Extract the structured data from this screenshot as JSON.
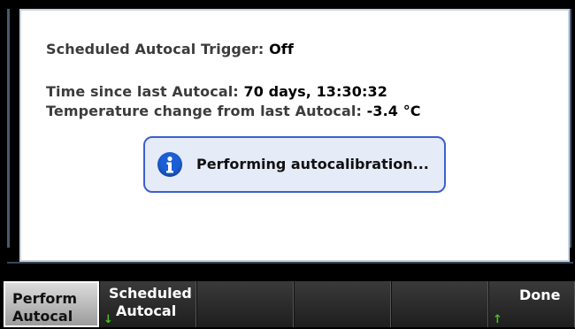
{
  "dialog": {
    "trigger_label": "Scheduled Autocal Trigger:",
    "trigger_value": "Off",
    "time_label": "Time since last Autocal:",
    "time_value": "70 days, 13:30:32",
    "temp_label": "Temperature change from last Autocal:",
    "temp_value": "-3.4 °C",
    "message": "Performing autocalibration...",
    "message_icon": "info-icon"
  },
  "softkeys": [
    {
      "line1": "Perform",
      "line2": "Autocal"
    },
    {
      "line1": "Scheduled",
      "line2": "Autocal"
    },
    {
      "line1": "",
      "line2": ""
    },
    {
      "line1": "",
      "line2": ""
    },
    {
      "line1": "",
      "line2": ""
    },
    {
      "line1": "Done",
      "line2": ""
    }
  ],
  "colors": {
    "accent": "#3e5fcf",
    "icon": "#1b5fd6",
    "arrow": "#4cc21c"
  }
}
